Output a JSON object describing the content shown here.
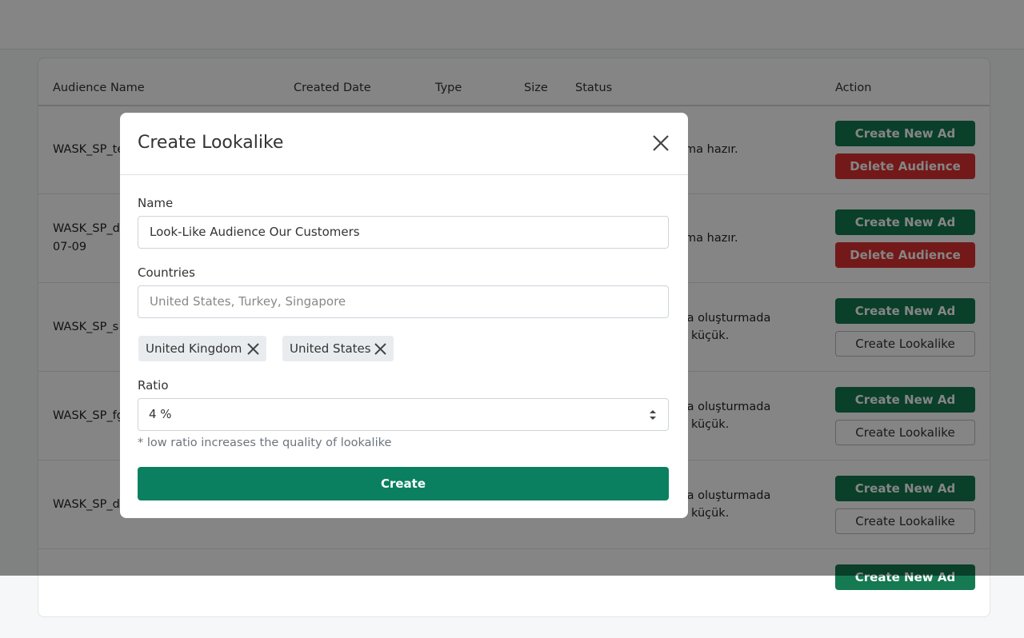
{
  "table": {
    "headers": [
      "Audience Name",
      "Created Date",
      "Type",
      "Size",
      "Status",
      "Action"
    ],
    "rows": [
      {
        "name": "WASK_SP_te",
        "name2": "",
        "status1": "ıma hazır.",
        "status2": "",
        "primary": "Create New Ad",
        "secondary": "Delete Audience"
      },
      {
        "name": "WASK_SP_d",
        "name2": "07-09",
        "status1": "ıma hazır.",
        "status2": "",
        "primary": "Create New Ad",
        "secondary": "Delete Audience"
      },
      {
        "name": "WASK_SP_s",
        "name2": "",
        "status1": "ya oluşturmada",
        "status2": "küçük.",
        "primary": "Create New Ad",
        "secondary": "Create Lookalike"
      },
      {
        "name": "WASK_SP_fg",
        "name2": "",
        "status1": "ya oluşturmada",
        "status2": "küçük.",
        "primary": "Create New Ad",
        "secondary": "Create Lookalike"
      },
      {
        "name": "WASK_SP_d",
        "name2": "",
        "status1": "ya oluşturmada",
        "status2": "küçük.",
        "primary": "Create New Ad",
        "secondary": "Create Lookalike"
      },
      {
        "primary": "Create New Ad"
      }
    ]
  },
  "modal": {
    "title": "Create Lookalike",
    "close_icon": "close-icon",
    "name_label": "Name",
    "name_value": "Look-Like Audience Our Customers",
    "countries_label": "Countries",
    "countries_placeholder": "United States, Turkey, Singapore",
    "chips": [
      "United Kingdom",
      "United States"
    ],
    "ratio_label": "Ratio",
    "ratio_value": "4 %",
    "hint": "* low ratio increases the quality of lookalike",
    "create_label": "Create"
  },
  "colors": {
    "primary_green": "#0a8060",
    "danger": "#dc3030"
  }
}
